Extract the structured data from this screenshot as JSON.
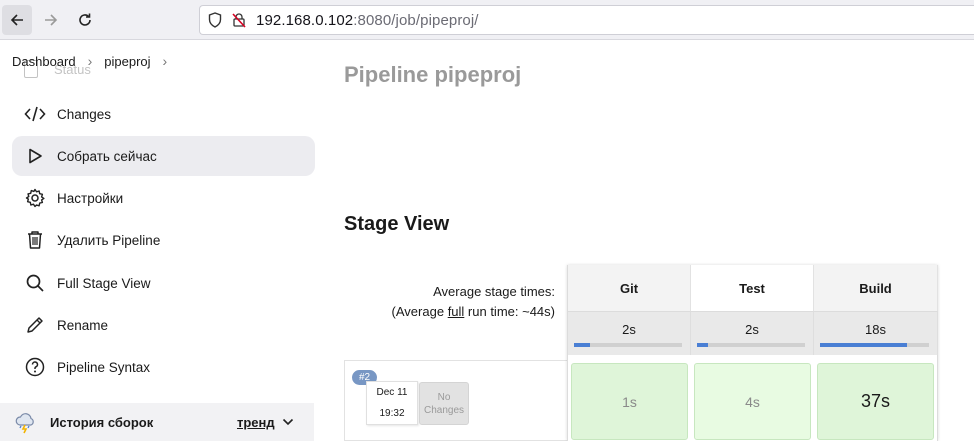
{
  "browser": {
    "url_host": "192.168.0.102",
    "url_rest": ":8080/job/pipeproj/"
  },
  "breadcrumb": {
    "items": [
      "Dashboard",
      "pipeproj"
    ]
  },
  "sidebar": {
    "status_label": "Status",
    "items": [
      {
        "label": "Changes",
        "icon": "code-icon"
      },
      {
        "label": "Собрать сейчас",
        "icon": "play-icon"
      },
      {
        "label": "Настройки",
        "icon": "gear-icon"
      },
      {
        "label": "Удалить Pipeline",
        "icon": "trash-icon"
      },
      {
        "label": "Full Stage View",
        "icon": "search-icon"
      },
      {
        "label": "Rename",
        "icon": "pencil-icon"
      },
      {
        "label": "Pipeline Syntax",
        "icon": "help-icon"
      }
    ],
    "history": {
      "title": "История сборок",
      "trend": "тренд"
    }
  },
  "main": {
    "page_title": "Pipeline pipeproj",
    "stage_view_title": "Stage View",
    "avg_stage_label": "Average stage times:",
    "avg_full_prefix": "(Average ",
    "avg_full_word": "full",
    "avg_full_suffix": " run time: ~44s)",
    "stages": [
      {
        "name": "Git",
        "avg": "2s",
        "avg_fill": 0.15,
        "result": "1s"
      },
      {
        "name": "Test",
        "avg": "2s",
        "avg_fill": 0.1,
        "result": "4s"
      },
      {
        "name": "Build",
        "avg": "18s",
        "avg_fill": 0.8,
        "result": "37s"
      }
    ],
    "build": {
      "number": "#2",
      "date": "Dec 11",
      "time": "19:32",
      "changes": "No Changes"
    }
  }
}
